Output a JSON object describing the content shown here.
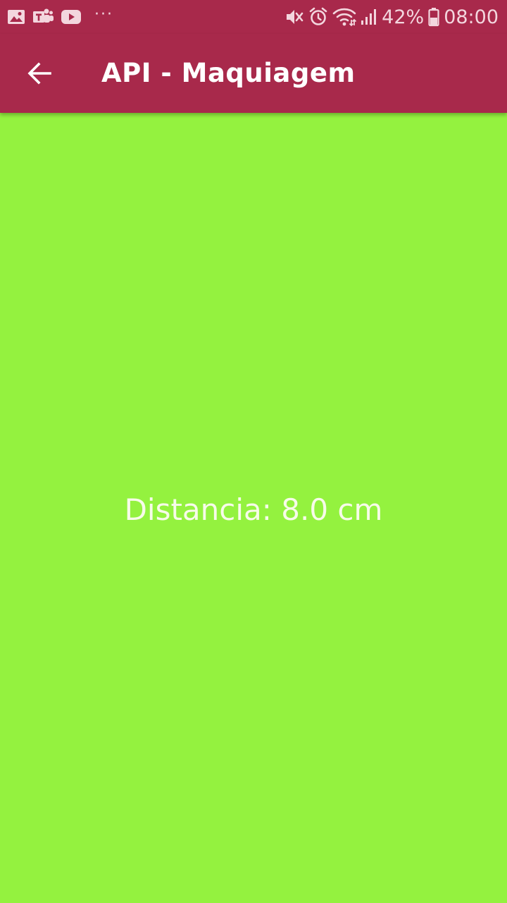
{
  "status_bar": {
    "battery_percent": "42%",
    "time": "08:00",
    "overflow_dots": "···",
    "left_icons": [
      "gallery-icon",
      "teams-icon",
      "youtube-icon"
    ],
    "right_icons": [
      "mute-icon",
      "alarm-icon",
      "wifi-icon",
      "signal-icon",
      "battery-icon"
    ]
  },
  "app_bar": {
    "back_icon": "arrow-back-icon",
    "title": "API - Maquiagem"
  },
  "main": {
    "distance_text": "Distancia: 8.0 cm"
  },
  "colors": {
    "primary": "#a8294b",
    "background": "#94f23f",
    "on_primary": "#ffffff"
  }
}
